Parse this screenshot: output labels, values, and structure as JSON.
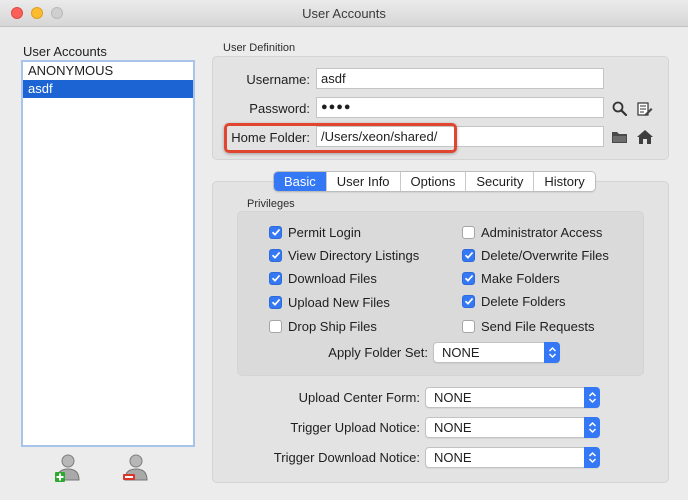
{
  "window": {
    "title": "User Accounts"
  },
  "users": {
    "title": "User Accounts",
    "items": [
      "ANONYMOUS",
      "asdf"
    ],
    "selected": "asdf"
  },
  "definition": {
    "title": "User Definition",
    "username_label": "Username:",
    "username_value": "asdf",
    "password_label": "Password:",
    "password_value": "●●●●",
    "home_label": "Home Folder:",
    "home_value": "/Users/xeon/shared/"
  },
  "tabs": [
    "Basic",
    "User Info",
    "Options",
    "Security",
    "History"
  ],
  "active_tab": "Basic",
  "privileges": {
    "title": "Privileges",
    "left": [
      {
        "label": "Permit Login",
        "checked": true
      },
      {
        "label": "View Directory Listings",
        "checked": true
      },
      {
        "label": "Download Files",
        "checked": true
      },
      {
        "label": "Upload New Files",
        "checked": true
      },
      {
        "label": "Drop Ship Files",
        "checked": false
      }
    ],
    "right": [
      {
        "label": "Administrator Access",
        "checked": false
      },
      {
        "label": "Delete/Overwrite Files",
        "checked": true
      },
      {
        "label": "Make Folders",
        "checked": true
      },
      {
        "label": "Delete Folders",
        "checked": true
      },
      {
        "label": "Send File Requests",
        "checked": false
      }
    ],
    "folder_set_label": "Apply Folder Set:",
    "folder_set_value": "NONE"
  },
  "notices": {
    "upload_center_label": "Upload Center Form:",
    "upload_center_value": "NONE",
    "trigger_upload_label": "Trigger Upload Notice:",
    "trigger_upload_value": "NONE",
    "trigger_download_label": "Trigger Download Notice:",
    "trigger_download_value": "NONE"
  },
  "colors": {
    "accent": "#3478f6",
    "selection": "#1c64d3",
    "highlight": "#e0462f"
  },
  "icons": {
    "search": "search-icon",
    "edit": "edit-icon",
    "folder": "folder-icon",
    "home": "home-icon",
    "add_user": "add-user-icon",
    "remove_user": "remove-user-icon"
  }
}
